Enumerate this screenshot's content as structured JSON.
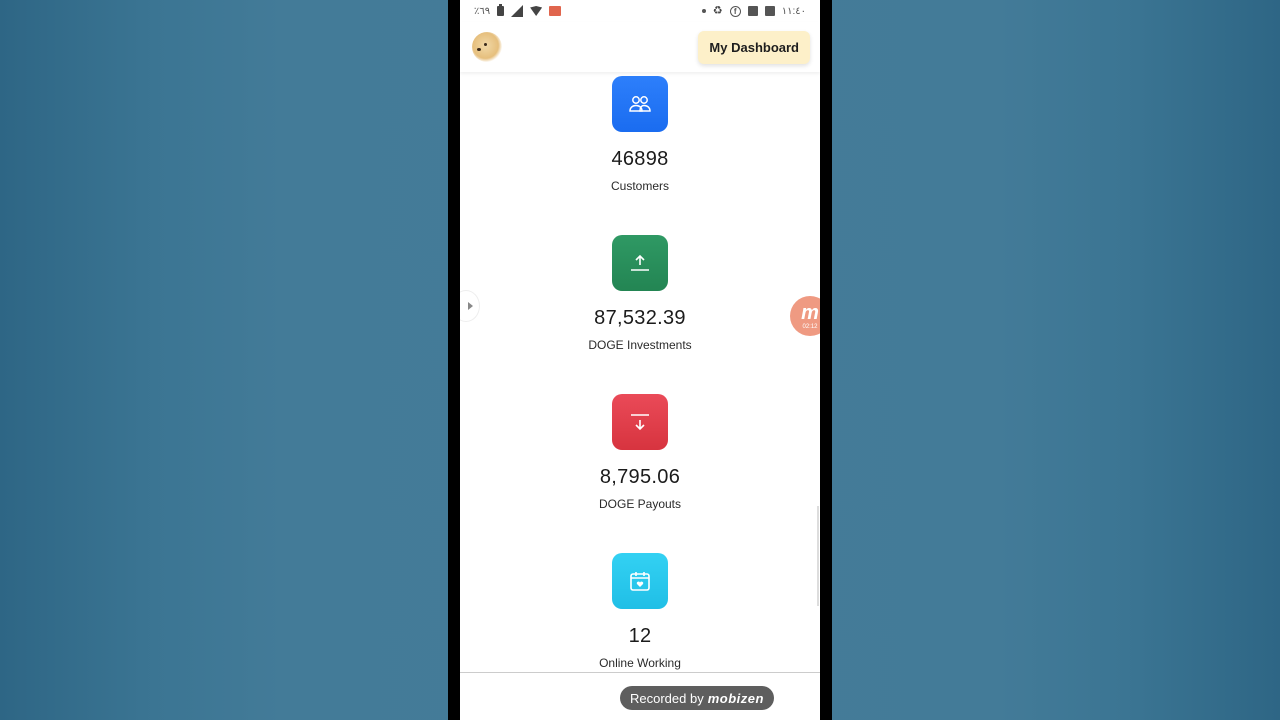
{
  "status_bar": {
    "battery_text": "٪٦٩",
    "time": "١١:٤٠",
    "left_icons": [
      "battery-icon",
      "signal-icon",
      "wifi-icon",
      "cast-icon"
    ],
    "right_icons": [
      "dot-icon",
      "sync-icon",
      "facebook-icon",
      "news-icon",
      "gallery-icon"
    ]
  },
  "header": {
    "logo_alt": "doge-logo",
    "dashboard_button": "My Dashboard"
  },
  "stats": [
    {
      "value": "46898",
      "label": "Customers",
      "icon": "users-icon",
      "color": "#1f72f5"
    },
    {
      "value": "87,532.39",
      "label": "DOGE Investments",
      "icon": "upload-icon",
      "color": "#29905b"
    },
    {
      "value": "8,795.06",
      "label": "DOGE Payouts",
      "icon": "download-icon",
      "color": "#e0404c"
    },
    {
      "value": "12",
      "label": "Online Working",
      "icon": "calendar-heart-icon",
      "color": "#28c7ec"
    }
  ],
  "overlay": {
    "mobizen_letter": "m",
    "mobizen_timer": "02:12",
    "recorded_by": "Recorded by",
    "recorder_brand": "mobizen"
  }
}
